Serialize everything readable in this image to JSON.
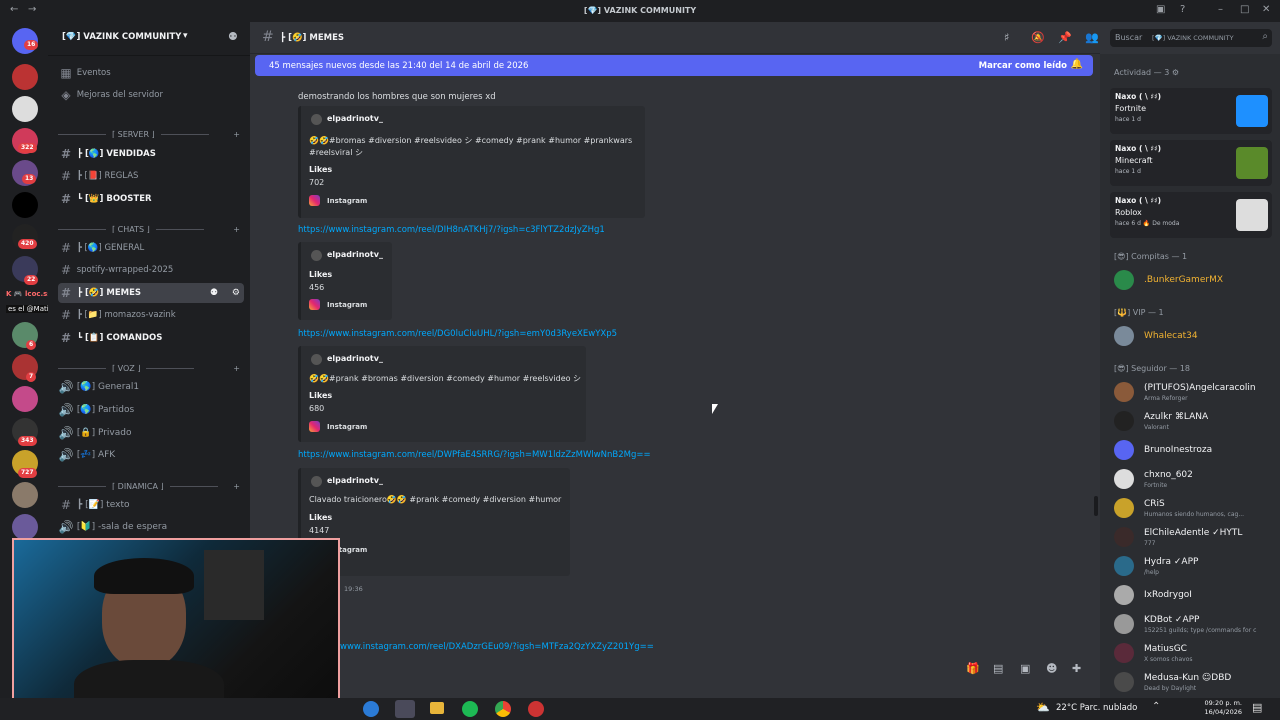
{
  "window": {
    "title": "[💎] VAZINK COMMUNITY"
  },
  "guild": {
    "name": "[💎] VAZINK COMMUNITY",
    "chevron": "▾"
  },
  "top_links": [
    "Eventos",
    "Mejoras del servidor"
  ],
  "categories": [
    "⌈ SERVER ⌋",
    "⌈ CHATS ⌋",
    "⌈ VOZ ⌋",
    "⌈ DINAMICA ⌋"
  ],
  "channels": [
    {
      "label": "┣ [🌎] VENDIDAS"
    },
    {
      "label": "┣ [📕] REGLAS"
    },
    {
      "label": "┗ [👑] BOOSTER"
    },
    {
      "label": "┣ [🌎] GENERAL"
    },
    {
      "label": "spotify-wrrapped-2025"
    },
    {
      "label": "┣ [🤣] MEMES"
    },
    {
      "label": "┣ [📁] momazos-vazink"
    },
    {
      "label": "┗ [📋] COMANDOS"
    },
    {
      "label": "[🌎] General1"
    },
    {
      "label": "[🌎] Partidos"
    },
    {
      "label": "[🔒] Privado"
    },
    {
      "label": "[💤] AFK"
    },
    {
      "label": "┣ [📝] texto"
    },
    {
      "label": "[🔰] -sala de espera"
    }
  ],
  "rail_badges": [
    "16",
    "322",
    "13",
    "420",
    "22",
    "6",
    "7",
    "343",
    "727"
  ],
  "overlay_text": {
    "line1": "K 🎮 lcoc.sshugs",
    "line2": "es el @Mati_Zen"
  },
  "header": {
    "channel": "┣ [🤣] MEMES",
    "search_placeholder": "Buscar",
    "search_server": "[💎] VAZINK COMMUNITY"
  },
  "new_messages": {
    "text": "45 mensajes nuevos desde las 21:40 del 14 de abril de 2026",
    "mark_read": "Marcar como leído"
  },
  "messages": {
    "intro": "demostrando los hombres que son mujeres xd",
    "embeds": [
      {
        "author": "elpadrinotv_",
        "desc1": "🤣🤣#bromas #diversion #reelsvideo シ #comedy #prank #humor #prankwars",
        "desc2": "#reelsviral シ",
        "field": "Likes",
        "value": "702",
        "source": "Instagram"
      },
      {
        "author": "elpadrinotv_",
        "desc1": "",
        "desc2": "",
        "field": "Likes",
        "value": "456",
        "source": "Instagram"
      },
      {
        "author": "elpadrinotv_",
        "desc1": "🤣🤣#prank #bromas #diversion #comedy #humor #reelsvideo シ",
        "desc2": "",
        "field": "Likes",
        "value": "680",
        "source": "Instagram"
      },
      {
        "author": "elpadrinotv_",
        "desc1": "Clavado traicionero🤣🤣 #prank #comedy #diversion #humor",
        "desc2": "",
        "field": "Likes",
        "value": "4147",
        "source": "Instagram"
      }
    ],
    "links": [
      "https://www.instagram.com/reel/DIH8nATKHj7/?igsh=c3FlYTZ2dzJyZHg1",
      "https://www.instagram.com/reel/DG0luCluUHL/?igsh=emY0d3RyeXEwYXp5",
      "https://www.instagram.com/reel/DWPfaE4SRRG/?igsh=MW1ldzZzMWlwNnB2Mg==",
      "www.instagram.com/reel/DXADzrGEu09/?igsh=MTFza2QzYXZyZ201Yg=="
    ],
    "timestamp": "19:36"
  },
  "members": {
    "activity_header": "Actividad — 3 ⚙",
    "activities": [
      {
        "name": "Naxo ( \\ ♯♯)",
        "game": "Fortnite",
        "time": "hace 1 d"
      },
      {
        "name": "Naxo ( \\ ♯♯)",
        "game": "Minecraft",
        "time": "hace 1 d"
      },
      {
        "name": "Naxo ( \\ ♯♯)",
        "game": "Roblox",
        "time": "hace 6 d  🔥 De moda"
      }
    ],
    "groups": [
      {
        "title": "[😎] Compitas — 1",
        "members": [
          {
            "name": ".BunkerGamerMX",
            "status": "",
            "color": "#f0b232"
          }
        ]
      },
      {
        "title": "[🔱] VIP — 1",
        "members": [
          {
            "name": "Whalecat34",
            "status": "",
            "color": "#f0b232"
          }
        ]
      },
      {
        "title": "[😎] Seguidor — 18",
        "members": [
          {
            "name": "(PITUFOS)Angelcaracolin",
            "status": "Arma Reforger",
            "color": "#f2f3f5"
          },
          {
            "name": "Azulkr  ⌘LANA",
            "status": "Valorant",
            "color": "#f2f3f5"
          },
          {
            "name": "BrunoInestroza",
            "status": "",
            "color": "#f2f3f5"
          },
          {
            "name": "chxno_602",
            "status": "Fortnite",
            "color": "#f2f3f5"
          },
          {
            "name": "CRiS",
            "status": "Humanos siendo humanos, cag...",
            "color": "#f2f3f5"
          },
          {
            "name": "ElChileAdentle  ✓HYTL",
            "status": "777",
            "color": "#f2f3f5"
          },
          {
            "name": "Hydra  ✓APP",
            "status": "/help",
            "color": "#f2f3f5"
          },
          {
            "name": "IxRodrygoI",
            "status": "",
            "color": "#f2f3f5"
          },
          {
            "name": "KDBot  ✓APP",
            "status": "152251 guilds; type /commands for c",
            "color": "#f2f3f5"
          },
          {
            "name": "MatiusGC",
            "status": "X somos chavos",
            "color": "#f2f3f5"
          },
          {
            "name": "Medusa-Kun  ☺DBD",
            "status": "Dead by Daylight",
            "color": "#f2f3f5"
          }
        ]
      }
    ]
  },
  "taskbar": {
    "weather": "22°C  Parc. nublado",
    "time": "09:20 p. m.",
    "date": "16/04/2026"
  }
}
